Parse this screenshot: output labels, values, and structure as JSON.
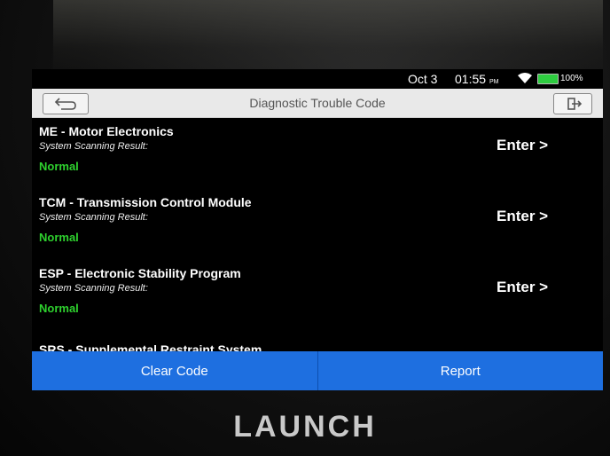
{
  "status_bar": {
    "date": "Oct 3",
    "time": "01:55",
    "ampm": "PM",
    "battery": "100%",
    "battery_color": "#2ecc40"
  },
  "titlebar": {
    "title": "Diagnostic Trouble Code",
    "back_icon": "back-arrow-icon",
    "exit_icon": "exit-icon"
  },
  "systems": [
    {
      "name": "ME - Motor Electronics",
      "label": "System Scanning Result:",
      "result": "Normal",
      "action": "Enter >"
    },
    {
      "name": "TCM - Transmission Control Module",
      "label": "System Scanning Result:",
      "result": "Normal",
      "action": "Enter >"
    },
    {
      "name": "ESP - Electronic Stability Program",
      "label": "System Scanning Result:",
      "result": "Normal",
      "action": "Enter >"
    }
  ],
  "partial_item": "SRS - Supplemental Restraint System",
  "buttons": {
    "clear": "Clear Code",
    "report": "Report"
  },
  "brand": "LAUNCH",
  "colors": {
    "accent": "#1e6fe0",
    "normal": "#2ed12e"
  }
}
